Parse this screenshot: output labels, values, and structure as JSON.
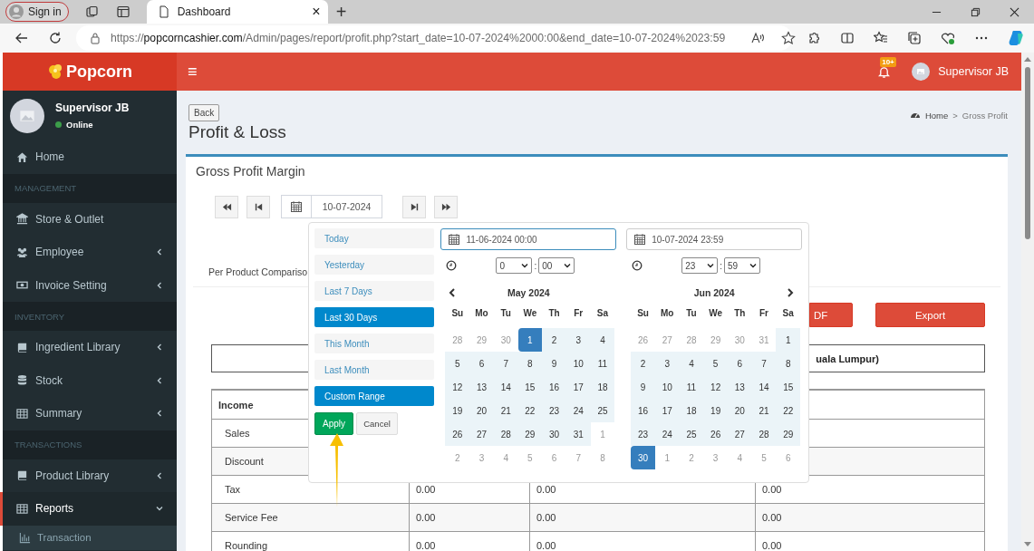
{
  "browser": {
    "profile_button": "Sign in",
    "tab": {
      "title": "Dashboard",
      "close": "×"
    },
    "new_tab": "+",
    "url": {
      "scheme": "https://",
      "host": "popcorncashier.com",
      "path": "/Admin/pages/report/profit.php?start_date=10-07-2024%2000:00&end_date=10-07-2024%2023:59"
    }
  },
  "header": {
    "logo": "Popcorn",
    "menu_toggle": "≡",
    "notification_badge": "10+",
    "user": "Supervisor JB"
  },
  "sidebar": {
    "user": {
      "name": "Supervisor JB",
      "status": "Online"
    },
    "menu": [
      {
        "kind": "link",
        "label": "Home",
        "has_submenu": false,
        "selected": false
      },
      {
        "kind": "header",
        "label": "MANAGEMENT"
      },
      {
        "kind": "link",
        "label": "Store & Outlet",
        "has_submenu": false,
        "selected": false
      },
      {
        "kind": "link",
        "label": "Employee",
        "has_submenu": true,
        "expanded": false,
        "selected": false
      },
      {
        "kind": "link",
        "label": "Invoice Setting",
        "has_submenu": true,
        "expanded": false,
        "selected": false
      },
      {
        "kind": "header",
        "label": "INVENTORY"
      },
      {
        "kind": "link",
        "label": "Ingredient Library",
        "has_submenu": true,
        "expanded": false,
        "selected": false
      },
      {
        "kind": "link",
        "label": "Stock",
        "has_submenu": true,
        "expanded": false,
        "selected": false
      },
      {
        "kind": "link",
        "label": "Summary",
        "has_submenu": true,
        "expanded": false,
        "selected": false
      },
      {
        "kind": "header",
        "label": "TRANSACTIONS"
      },
      {
        "kind": "link",
        "label": "Product Library",
        "has_submenu": true,
        "expanded": false,
        "selected": false
      },
      {
        "kind": "link",
        "label": "Reports",
        "has_submenu": true,
        "expanded": true,
        "selected": true,
        "children": [
          {
            "label": "Transaction"
          }
        ]
      }
    ]
  },
  "page": {
    "back_button": "Back",
    "title": "Profit & Loss",
    "breadcrumb": {
      "separator": ">",
      "items": [
        "Home",
        "Gross Profit"
      ]
    },
    "card": {
      "title": "Gross Profit Margin",
      "date": "10-07-2024",
      "tab": "Per Product Compariso",
      "buttons": [
        {
          "kind": "pdf",
          "label": "DF"
        },
        {
          "kind": "export",
          "label": "Export"
        }
      ],
      "summary_box": "uala Lumpur)",
      "table": {
        "header": "Income",
        "rows": [
          {
            "label": "Sales",
            "values": []
          },
          {
            "label": "Discount",
            "values": []
          },
          {
            "label": "Tax",
            "values": [
              "0.00",
              "0.00",
              "0.00"
            ]
          },
          {
            "label": "Service Fee",
            "values": [
              "0.00",
              "0.00",
              "0.00"
            ]
          },
          {
            "label": "Rounding",
            "values": [
              "0.00",
              "0.00",
              "0.00"
            ]
          }
        ]
      }
    }
  },
  "date_picker": {
    "ranges": [
      {
        "label": "Today",
        "selected": false
      },
      {
        "label": "Yesterday",
        "selected": false
      },
      {
        "label": "Last 7 Days",
        "selected": false
      },
      {
        "label": "Last 30 Days",
        "selected": true
      },
      {
        "label": "This Month",
        "selected": false
      },
      {
        "label": "Last Month",
        "selected": false
      },
      {
        "label": "Custom Range",
        "selected": true
      }
    ],
    "apply": "Apply",
    "cancel": "Cancel",
    "calendars": [
      {
        "start_input": "11-06-2024 00:00",
        "focused": true,
        "hour": "0",
        "minute": "00",
        "separator": ":",
        "month": "May 2024",
        "prev": true,
        "weekdays": [
          "Su",
          "Mo",
          "Tu",
          "We",
          "Th",
          "Fr",
          "Sa"
        ],
        "weeks": [
          [
            {
              "d": "28",
              "kind": "off"
            },
            {
              "d": "29",
              "kind": "off"
            },
            {
              "d": "30",
              "kind": "off"
            },
            {
              "d": "1",
              "kind": "start"
            },
            {
              "d": "2",
              "kind": "range"
            },
            {
              "d": "3",
              "kind": "range"
            },
            {
              "d": "4",
              "kind": "range"
            }
          ],
          [
            {
              "d": "5",
              "kind": "range"
            },
            {
              "d": "6",
              "kind": "range"
            },
            {
              "d": "7",
              "kind": "range"
            },
            {
              "d": "8",
              "kind": "range"
            },
            {
              "d": "9",
              "kind": "range"
            },
            {
              "d": "10",
              "kind": "range"
            },
            {
              "d": "11",
              "kind": "range"
            }
          ],
          [
            {
              "d": "12",
              "kind": "range"
            },
            {
              "d": "13",
              "kind": "range"
            },
            {
              "d": "14",
              "kind": "range"
            },
            {
              "d": "15",
              "kind": "range"
            },
            {
              "d": "16",
              "kind": "range"
            },
            {
              "d": "17",
              "kind": "range"
            },
            {
              "d": "18",
              "kind": "range"
            }
          ],
          [
            {
              "d": "19",
              "kind": "range"
            },
            {
              "d": "20",
              "kind": "range"
            },
            {
              "d": "21",
              "kind": "range"
            },
            {
              "d": "22",
              "kind": "range"
            },
            {
              "d": "23",
              "kind": "range"
            },
            {
              "d": "24",
              "kind": "range"
            },
            {
              "d": "25",
              "kind": "range"
            }
          ],
          [
            {
              "d": "26",
              "kind": "range"
            },
            {
              "d": "27",
              "kind": "range"
            },
            {
              "d": "28",
              "kind": "range"
            },
            {
              "d": "29",
              "kind": "range"
            },
            {
              "d": "30",
              "kind": "range"
            },
            {
              "d": "31",
              "kind": "range"
            },
            {
              "d": "1",
              "kind": "off"
            }
          ],
          [
            {
              "d": "2",
              "kind": "off"
            },
            {
              "d": "3",
              "kind": "off"
            },
            {
              "d": "4",
              "kind": "off"
            },
            {
              "d": "5",
              "kind": "off"
            },
            {
              "d": "6",
              "kind": "off"
            },
            {
              "d": "7",
              "kind": "off"
            },
            {
              "d": "8",
              "kind": "off"
            }
          ]
        ]
      },
      {
        "start_input": "10-07-2024 23:59",
        "focused": false,
        "hour": "23",
        "minute": "59",
        "separator": ":",
        "month": "Jun 2024",
        "next": true,
        "weekdays": [
          "Su",
          "Mo",
          "Tu",
          "We",
          "Th",
          "Fr",
          "Sa"
        ],
        "weeks": [
          [
            {
              "d": "26",
              "kind": "off"
            },
            {
              "d": "27",
              "kind": "off"
            },
            {
              "d": "28",
              "kind": "off"
            },
            {
              "d": "29",
              "kind": "off"
            },
            {
              "d": "30",
              "kind": "off"
            },
            {
              "d": "31",
              "kind": "off"
            },
            {
              "d": "1",
              "kind": "range"
            }
          ],
          [
            {
              "d": "2",
              "kind": "range"
            },
            {
              "d": "3",
              "kind": "range"
            },
            {
              "d": "4",
              "kind": "range"
            },
            {
              "d": "5",
              "kind": "range"
            },
            {
              "d": "6",
              "kind": "range"
            },
            {
              "d": "7",
              "kind": "range"
            },
            {
              "d": "8",
              "kind": "range"
            }
          ],
          [
            {
              "d": "9",
              "kind": "range"
            },
            {
              "d": "10",
              "kind": "range"
            },
            {
              "d": "11",
              "kind": "range"
            },
            {
              "d": "12",
              "kind": "range"
            },
            {
              "d": "13",
              "kind": "range"
            },
            {
              "d": "14",
              "kind": "range"
            },
            {
              "d": "15",
              "kind": "range"
            }
          ],
          [
            {
              "d": "16",
              "kind": "range"
            },
            {
              "d": "17",
              "kind": "range"
            },
            {
              "d": "18",
              "kind": "range"
            },
            {
              "d": "19",
              "kind": "range"
            },
            {
              "d": "20",
              "kind": "range"
            },
            {
              "d": "21",
              "kind": "range"
            },
            {
              "d": "22",
              "kind": "range"
            }
          ],
          [
            {
              "d": "23",
              "kind": "range"
            },
            {
              "d": "24",
              "kind": "range"
            },
            {
              "d": "25",
              "kind": "range"
            },
            {
              "d": "26",
              "kind": "range"
            },
            {
              "d": "27",
              "kind": "range"
            },
            {
              "d": "28",
              "kind": "range"
            },
            {
              "d": "29",
              "kind": "range"
            }
          ],
          [
            {
              "d": "30",
              "kind": "end"
            },
            {
              "d": "1",
              "kind": "off"
            },
            {
              "d": "2",
              "kind": "off"
            },
            {
              "d": "3",
              "kind": "off"
            },
            {
              "d": "4",
              "kind": "off"
            },
            {
              "d": "5",
              "kind": "off"
            },
            {
              "d": "6",
              "kind": "off"
            }
          ]
        ]
      }
    ]
  }
}
